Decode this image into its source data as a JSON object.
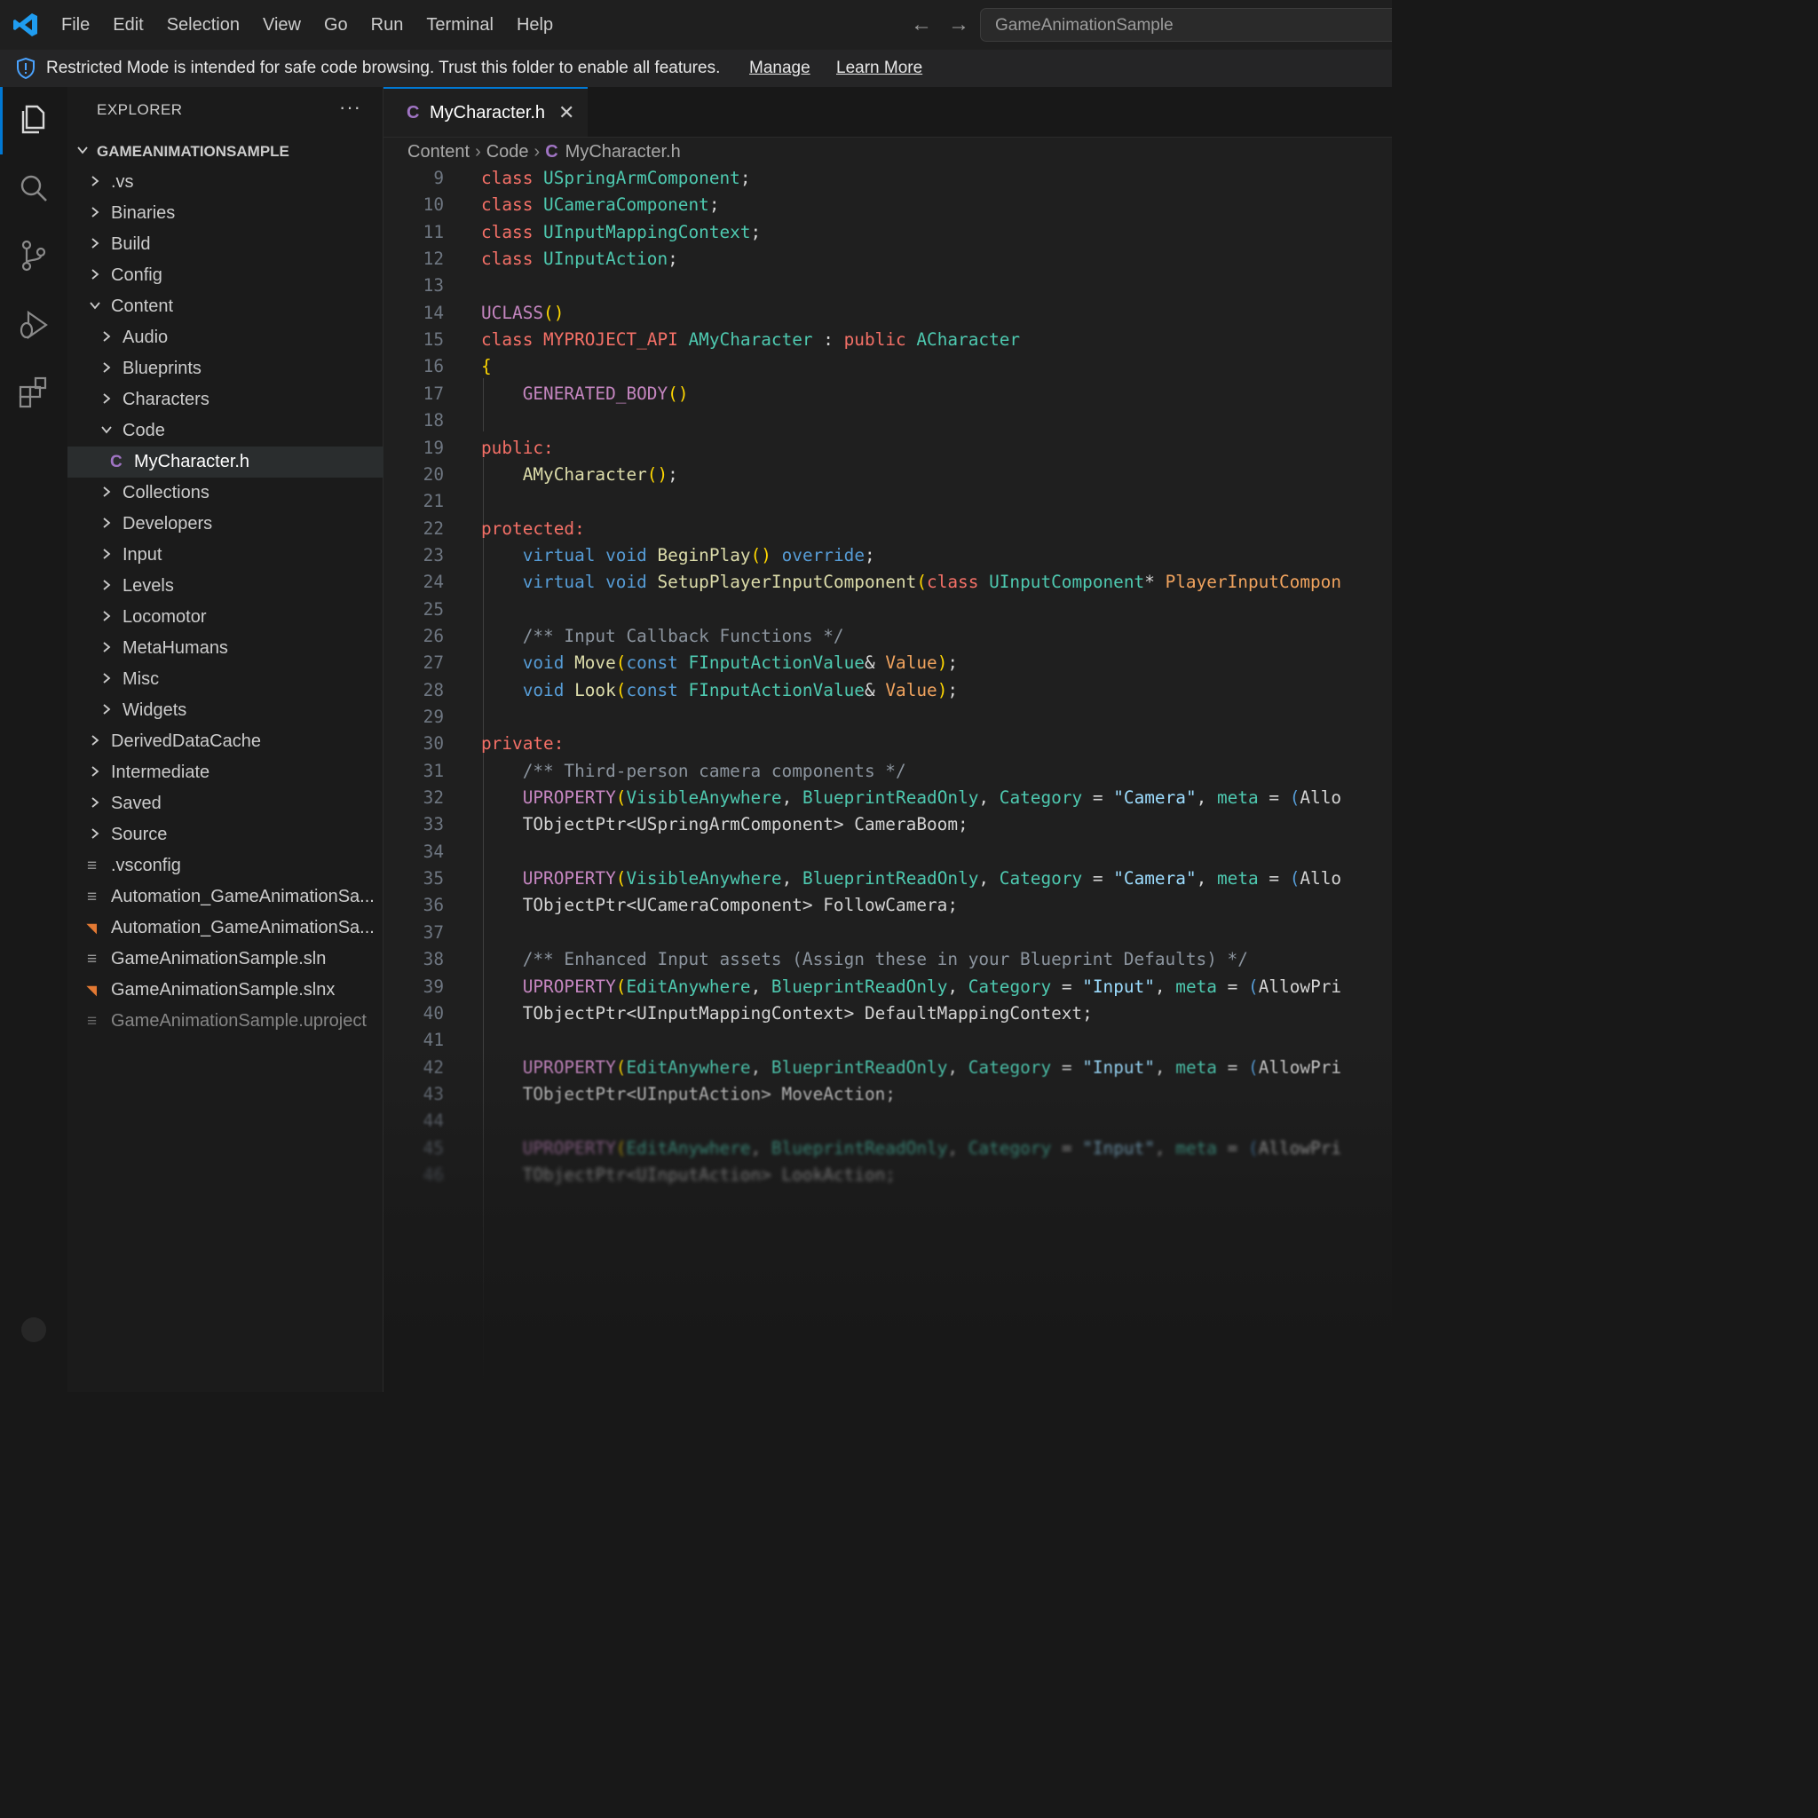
{
  "titlebar": {
    "logo_icon": "vscode-logo-icon",
    "menu": [
      "File",
      "Edit",
      "Selection",
      "View",
      "Go",
      "Run",
      "Terminal",
      "Help"
    ],
    "command_center": "GameAnimationSample"
  },
  "banner": {
    "text": "Restricted Mode is intended for safe code browsing. Trust this folder to enable all features.",
    "manage": "Manage",
    "learn_more": "Learn More"
  },
  "activity_bar": [
    "explorer-icon",
    "search-icon",
    "source-control-icon",
    "run-debug-icon",
    "extensions-icon"
  ],
  "sidebar": {
    "title": "EXPLORER",
    "more": "···",
    "root": "GAMEANIMATIONSAMPLE",
    "tree": [
      {
        "label": ".vs",
        "kind": "folder",
        "depth": 1,
        "open": false
      },
      {
        "label": "Binaries",
        "kind": "folder",
        "depth": 1,
        "open": false
      },
      {
        "label": "Build",
        "kind": "folder",
        "depth": 1,
        "open": false
      },
      {
        "label": "Config",
        "kind": "folder",
        "depth": 1,
        "open": false
      },
      {
        "label": "Content",
        "kind": "folder",
        "depth": 1,
        "open": true
      },
      {
        "label": "Audio",
        "kind": "folder",
        "depth": 2,
        "open": false
      },
      {
        "label": "Blueprints",
        "kind": "folder",
        "depth": 2,
        "open": false
      },
      {
        "label": "Characters",
        "kind": "folder",
        "depth": 2,
        "open": false
      },
      {
        "label": "Code",
        "kind": "folder",
        "depth": 2,
        "open": true
      },
      {
        "label": "MyCharacter.h",
        "kind": "c-file",
        "depth": 3,
        "selected": true
      },
      {
        "label": "Collections",
        "kind": "folder",
        "depth": 2,
        "open": false
      },
      {
        "label": "Developers",
        "kind": "folder",
        "depth": 2,
        "open": false
      },
      {
        "label": "Input",
        "kind": "folder",
        "depth": 2,
        "open": false
      },
      {
        "label": "Levels",
        "kind": "folder",
        "depth": 2,
        "open": false
      },
      {
        "label": "Locomotor",
        "kind": "folder",
        "depth": 2,
        "open": false
      },
      {
        "label": "MetaHumans",
        "kind": "folder",
        "depth": 2,
        "open": false
      },
      {
        "label": "Misc",
        "kind": "folder",
        "depth": 2,
        "open": false
      },
      {
        "label": "Widgets",
        "kind": "folder",
        "depth": 2,
        "open": false
      },
      {
        "label": "DerivedDataCache",
        "kind": "folder",
        "depth": 1,
        "open": false
      },
      {
        "label": "Intermediate",
        "kind": "folder",
        "depth": 1,
        "open": false
      },
      {
        "label": "Saved",
        "kind": "folder",
        "depth": 1,
        "open": false
      },
      {
        "label": "Source",
        "kind": "folder",
        "depth": 1,
        "open": false
      },
      {
        "label": ".vsconfig",
        "kind": "text-file",
        "depth": 1
      },
      {
        "label": "Automation_GameAnimationSa...",
        "kind": "text-file",
        "depth": 1
      },
      {
        "label": "Automation_GameAnimationSa...",
        "kind": "rss-file",
        "depth": 1
      },
      {
        "label": "GameAnimationSample.sln",
        "kind": "text-file",
        "depth": 1
      },
      {
        "label": "GameAnimationSample.slnx",
        "kind": "rss-file",
        "depth": 1
      },
      {
        "label": "GameAnimationSample.uproject",
        "kind": "text-file",
        "depth": 1,
        "dim": true
      }
    ]
  },
  "editor": {
    "tab": {
      "icon": "C",
      "label": "MyCharacter.h",
      "close": "✕"
    },
    "breadcrumbs": [
      "Content",
      "Code",
      "MyCharacter.h"
    ],
    "breadcrumb_icon": "C",
    "colors": {
      "keyword": "#f47067",
      "type": "#4ec9b0",
      "macro": "#c586c0",
      "func": "#dcdcaa",
      "plain": "#d4d4d4",
      "comment": "#8b949e",
      "string": "#9cdcfe",
      "brace": "#ffd700",
      "storage": "#569cd6",
      "param": "#f0a35e"
    },
    "lines": [
      {
        "n": "9",
        "t": [
          [
            "keyword",
            "class "
          ],
          [
            "type",
            "USpringArmComponent"
          ],
          [
            "plain",
            ";"
          ]
        ]
      },
      {
        "n": "10",
        "t": [
          [
            "keyword",
            "class "
          ],
          [
            "type",
            "UCameraComponent"
          ],
          [
            "plain",
            ";"
          ]
        ]
      },
      {
        "n": "11",
        "t": [
          [
            "keyword",
            "class "
          ],
          [
            "type",
            "UInputMappingContext"
          ],
          [
            "plain",
            ";"
          ]
        ]
      },
      {
        "n": "12",
        "t": [
          [
            "keyword",
            "class "
          ],
          [
            "type",
            "UInputAction"
          ],
          [
            "plain",
            ";"
          ]
        ]
      },
      {
        "n": "13",
        "t": []
      },
      {
        "n": "14",
        "t": [
          [
            "macro",
            "UCLASS"
          ],
          [
            "brace",
            "()"
          ]
        ]
      },
      {
        "n": "15",
        "t": [
          [
            "keyword",
            "class "
          ],
          [
            "keyword",
            "MYPROJECT_API "
          ],
          [
            "type",
            "AMyCharacter"
          ],
          [
            "plain",
            " : "
          ],
          [
            "keyword",
            "public "
          ],
          [
            "type",
            "ACharacter"
          ]
        ]
      },
      {
        "n": "16",
        "t": [
          [
            "brace",
            "{"
          ]
        ]
      },
      {
        "n": "17",
        "t": [
          [
            "plain",
            "    "
          ],
          [
            "macro",
            "GENERATED_BODY"
          ],
          [
            "brace",
            "()"
          ]
        ]
      },
      {
        "n": "18",
        "t": []
      },
      {
        "n": "19",
        "t": [
          [
            "keyword",
            "public:"
          ]
        ]
      },
      {
        "n": "20",
        "t": [
          [
            "plain",
            "    "
          ],
          [
            "func",
            "AMyCharacter"
          ],
          [
            "brace",
            "()"
          ],
          [
            "plain",
            ";"
          ]
        ]
      },
      {
        "n": "21",
        "t": []
      },
      {
        "n": "22",
        "t": [
          [
            "keyword",
            "protected:"
          ]
        ]
      },
      {
        "n": "23",
        "t": [
          [
            "plain",
            "    "
          ],
          [
            "storage",
            "virtual "
          ],
          [
            "storage",
            "void "
          ],
          [
            "func",
            "BeginPlay"
          ],
          [
            "brace",
            "() "
          ],
          [
            "storage",
            "override"
          ],
          [
            "plain",
            ";"
          ]
        ]
      },
      {
        "n": "24",
        "t": [
          [
            "plain",
            "    "
          ],
          [
            "storage",
            "virtual "
          ],
          [
            "storage",
            "void "
          ],
          [
            "func",
            "SetupPlayerInputComponent"
          ],
          [
            "brace",
            "("
          ],
          [
            "keyword",
            "class "
          ],
          [
            "type",
            "UInputComponent"
          ],
          [
            "plain",
            "* "
          ],
          [
            "param",
            "PlayerInputCompon"
          ]
        ]
      },
      {
        "n": "25",
        "t": []
      },
      {
        "n": "26",
        "t": [
          [
            "plain",
            "    "
          ],
          [
            "comment",
            "/** Input Callback Functions */"
          ]
        ]
      },
      {
        "n": "27",
        "t": [
          [
            "plain",
            "    "
          ],
          [
            "storage",
            "void "
          ],
          [
            "func",
            "Move"
          ],
          [
            "brace",
            "("
          ],
          [
            "storage",
            "const "
          ],
          [
            "type",
            "FInputActionValue"
          ],
          [
            "plain",
            "& "
          ],
          [
            "param",
            "Value"
          ],
          [
            "brace",
            ")"
          ],
          [
            "plain",
            ";"
          ]
        ]
      },
      {
        "n": "28",
        "t": [
          [
            "plain",
            "    "
          ],
          [
            "storage",
            "void "
          ],
          [
            "func",
            "Look"
          ],
          [
            "brace",
            "("
          ],
          [
            "storage",
            "const "
          ],
          [
            "type",
            "FInputActionValue"
          ],
          [
            "plain",
            "& "
          ],
          [
            "param",
            "Value"
          ],
          [
            "brace",
            ")"
          ],
          [
            "plain",
            ";"
          ]
        ]
      },
      {
        "n": "29",
        "t": []
      },
      {
        "n": "30",
        "t": [
          [
            "keyword",
            "private:"
          ]
        ]
      },
      {
        "n": "31",
        "t": [
          [
            "plain",
            "    "
          ],
          [
            "comment",
            "/** Third-person camera components */"
          ]
        ]
      },
      {
        "n": "32",
        "t": [
          [
            "plain",
            "    "
          ],
          [
            "macro",
            "UPROPERTY"
          ],
          [
            "brace",
            "("
          ],
          [
            "type",
            "VisibleAnywhere"
          ],
          [
            "plain",
            ", "
          ],
          [
            "type",
            "BlueprintReadOnly"
          ],
          [
            "plain",
            ", "
          ],
          [
            "type",
            "Category"
          ],
          [
            "plain",
            " = "
          ],
          [
            "string",
            "\"Camera\""
          ],
          [
            "plain",
            ", "
          ],
          [
            "type",
            "meta"
          ],
          [
            "plain",
            " = "
          ],
          [
            "storage",
            "("
          ],
          [
            "plain",
            "Allo"
          ]
        ]
      },
      {
        "n": "33",
        "t": [
          [
            "plain",
            "    TObjectPtr<USpringArmComponent> CameraBoom;"
          ]
        ]
      },
      {
        "n": "34",
        "t": []
      },
      {
        "n": "35",
        "t": [
          [
            "plain",
            "    "
          ],
          [
            "macro",
            "UPROPERTY"
          ],
          [
            "brace",
            "("
          ],
          [
            "type",
            "VisibleAnywhere"
          ],
          [
            "plain",
            ", "
          ],
          [
            "type",
            "BlueprintReadOnly"
          ],
          [
            "plain",
            ", "
          ],
          [
            "type",
            "Category"
          ],
          [
            "plain",
            " = "
          ],
          [
            "string",
            "\"Camera\""
          ],
          [
            "plain",
            ", "
          ],
          [
            "type",
            "meta"
          ],
          [
            "plain",
            " = "
          ],
          [
            "storage",
            "("
          ],
          [
            "plain",
            "Allo"
          ]
        ]
      },
      {
        "n": "36",
        "t": [
          [
            "plain",
            "    TObjectPtr<UCameraComponent> FollowCamera;"
          ]
        ]
      },
      {
        "n": "37",
        "t": []
      },
      {
        "n": "38",
        "t": [
          [
            "plain",
            "    "
          ],
          [
            "comment",
            "/** Enhanced Input assets (Assign these in your Blueprint Defaults) */"
          ]
        ]
      },
      {
        "n": "39",
        "t": [
          [
            "plain",
            "    "
          ],
          [
            "macro",
            "UPROPERTY"
          ],
          [
            "brace",
            "("
          ],
          [
            "type",
            "EditAnywhere"
          ],
          [
            "plain",
            ", "
          ],
          [
            "type",
            "BlueprintReadOnly"
          ],
          [
            "plain",
            ", "
          ],
          [
            "type",
            "Category"
          ],
          [
            "plain",
            " = "
          ],
          [
            "string",
            "\"Input\""
          ],
          [
            "plain",
            ", "
          ],
          [
            "type",
            "meta"
          ],
          [
            "plain",
            " = "
          ],
          [
            "storage",
            "("
          ],
          [
            "plain",
            "AllowPri"
          ]
        ]
      },
      {
        "n": "40",
        "t": [
          [
            "plain",
            "    TObjectPtr<UInputMappingContext> DefaultMappingContext;"
          ]
        ]
      },
      {
        "n": "41",
        "t": []
      },
      {
        "n": "42",
        "t": [
          [
            "plain",
            "    "
          ],
          [
            "macro",
            "UPROPERTY"
          ],
          [
            "brace",
            "("
          ],
          [
            "type",
            "EditAnywhere"
          ],
          [
            "plain",
            ", "
          ],
          [
            "type",
            "BlueprintReadOnly"
          ],
          [
            "plain",
            ", "
          ],
          [
            "type",
            "Category"
          ],
          [
            "plain",
            " = "
          ],
          [
            "string",
            "\"Input\""
          ],
          [
            "plain",
            ", "
          ],
          [
            "type",
            "meta"
          ],
          [
            "plain",
            " = "
          ],
          [
            "storage",
            "("
          ],
          [
            "plain",
            "AllowPri"
          ]
        ]
      },
      {
        "n": "43",
        "t": [
          [
            "plain",
            "    TObjectPtr<UInputAction> MoveAction;"
          ]
        ]
      },
      {
        "n": "44",
        "t": []
      },
      {
        "n": "45",
        "t": [
          [
            "plain",
            "    "
          ],
          [
            "macro",
            "UPROPERTY"
          ],
          [
            "brace",
            "("
          ],
          [
            "type",
            "EditAnywhere"
          ],
          [
            "plain",
            ", "
          ],
          [
            "type",
            "BlueprintReadOnly"
          ],
          [
            "plain",
            ", "
          ],
          [
            "type",
            "Category"
          ],
          [
            "plain",
            " = "
          ],
          [
            "string",
            "\"Input\""
          ],
          [
            "plain",
            ", "
          ],
          [
            "type",
            "meta"
          ],
          [
            "plain",
            " = "
          ],
          [
            "storage",
            "("
          ],
          [
            "plain",
            "AllowPri"
          ]
        ]
      },
      {
        "n": "46",
        "t": [
          [
            "plain",
            "    TObjectPtr<UInputAction> LookAction;"
          ]
        ]
      }
    ]
  }
}
